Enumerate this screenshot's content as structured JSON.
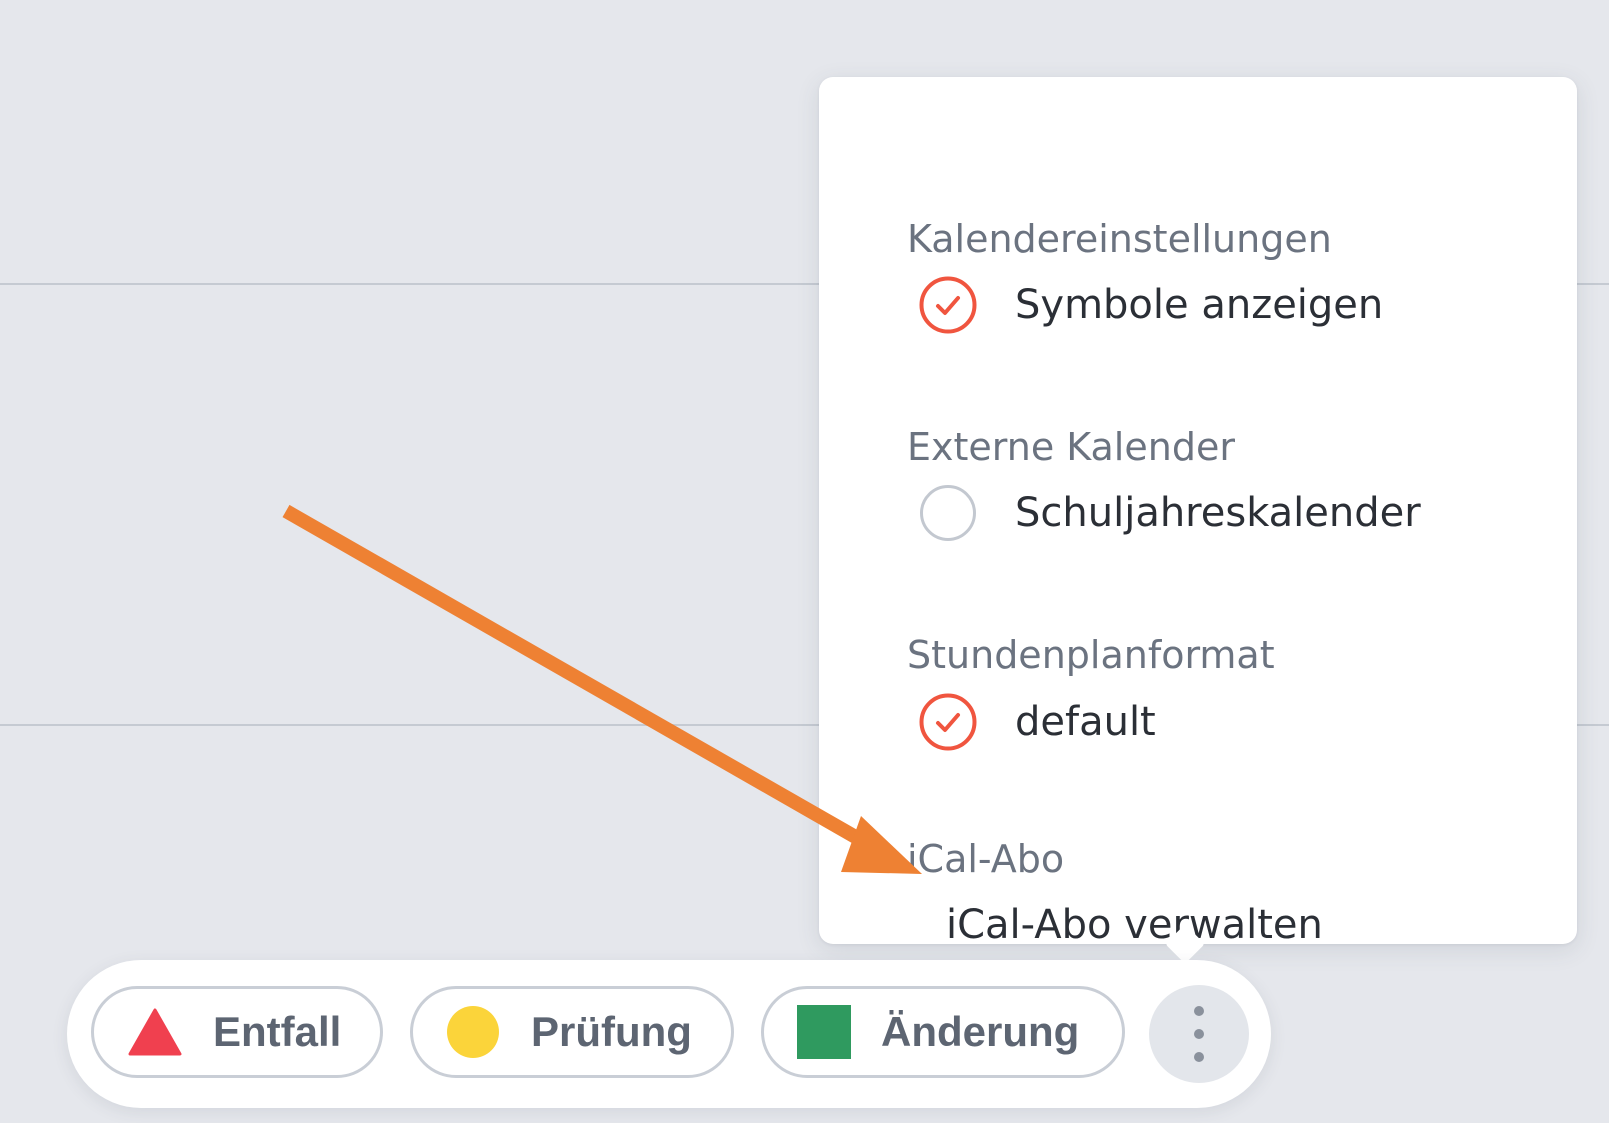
{
  "menu": {
    "sections": [
      {
        "title": "Kalendereinstellungen",
        "item": {
          "label": "Symbole anzeigen",
          "checked": true
        }
      },
      {
        "title": "Externe Kalender",
        "item": {
          "label": "Schuljahreskalender",
          "checked": false
        }
      },
      {
        "title": "Stundenplanformat",
        "item": {
          "label": "default",
          "checked": true
        }
      },
      {
        "title": "iCal-Abo",
        "link": "iCal-Abo verwalten"
      }
    ]
  },
  "legend": {
    "items": [
      {
        "label": "Entfall",
        "icon": "triangle-icon",
        "color": "#f0404f"
      },
      {
        "label": "Prüfung",
        "icon": "circle-icon",
        "color": "#fbd43a"
      },
      {
        "label": "Änderung",
        "icon": "square-icon",
        "color": "#2f9a5f"
      }
    ],
    "more_icon": "more-vertical-icon"
  },
  "colors": {
    "accent": "#f0553f",
    "background": "#e5e7ec",
    "annotation_arrow": "#ee8133"
  }
}
